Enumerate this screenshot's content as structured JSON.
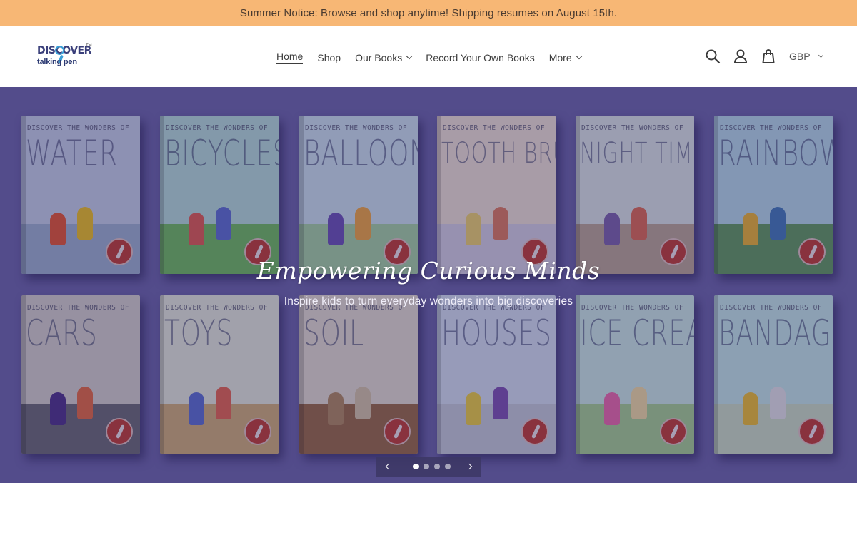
{
  "announcement": "Summer Notice: Browse and shop anytime! Shipping resumes on August 15th.",
  "logo": {
    "line1": "DISCOVER",
    "tm": "TM",
    "line2": "talking pen"
  },
  "nav": {
    "home": "Home",
    "shop": "Shop",
    "our_books": "Our Books",
    "record": "Record Your Own Books",
    "more": "More"
  },
  "header_icons": [
    "search-icon",
    "account-icon",
    "cart-icon"
  ],
  "currency": "GBP",
  "hero": {
    "title": "Empowering Curious Minds",
    "subtitle": "Inspire kids to turn everyday wonders into big discoveries",
    "series_label": "DISCOVER THE WONDERS OF",
    "books": [
      {
        "word": "WATER",
        "bg": "#c9d3e8",
        "ground": "#9fb4cf",
        "a": "#e8542a",
        "b": "#f2c31b"
      },
      {
        "word": "BICYCLES",
        "bg": "#b9e0da",
        "ground": "#6fbf5a",
        "a": "#e45b4b",
        "b": "#5b6fd0"
      },
      {
        "word": "BALLOONS",
        "bg": "#cfe5ef",
        "ground": "#a7d6a0",
        "a": "#6a4fb5",
        "b": "#f4a93a"
      },
      {
        "word": "TOOTH BRUSHES",
        "bg": "#f4e6d6",
        "ground": "#d9d3e4",
        "a": "#f2d66a",
        "b": "#e07b5a"
      },
      {
        "word": "NIGHT TIME",
        "bg": "#dfe9e6",
        "ground": "#bda892",
        "a": "#7b62a8",
        "b": "#e06a4c"
      },
      {
        "word": "RAINBOWS",
        "bg": "#b8ddeb",
        "ground": "#5f9c5a",
        "a": "#f0b62a",
        "b": "#3f7ab8"
      },
      {
        "word": "CARS",
        "bg": "#d8d4cb",
        "ground": "#6a6a70",
        "a": "#4b2f86",
        "b": "#e86a3a"
      },
      {
        "word": "TOYS",
        "bg": "#e9eedb",
        "ground": "#d3b173",
        "a": "#5a6fd0",
        "b": "#e8654a"
      },
      {
        "word": "SOIL",
        "bg": "#e8e1d0",
        "ground": "#9a6a3e",
        "a": "#b28a5a",
        "b": "#d8c7a3"
      },
      {
        "word": "HOUSES",
        "bg": "#d8e4f2",
        "ground": "#c9cfd9",
        "a": "#f0d23a",
        "b": "#7d4fb1"
      },
      {
        "word": "ICE CREAM",
        "bg": "#cfeee6",
        "ground": "#a9d38f",
        "a": "#f06aa8",
        "b": "#f7e0a0"
      },
      {
        "word": "BANDAGES",
        "bg": "#c7ece8",
        "ground": "#cfe3c4",
        "a": "#f2c22a",
        "b": "#e9e9e9"
      }
    ]
  },
  "slider": {
    "slides": 4,
    "active": 1
  }
}
